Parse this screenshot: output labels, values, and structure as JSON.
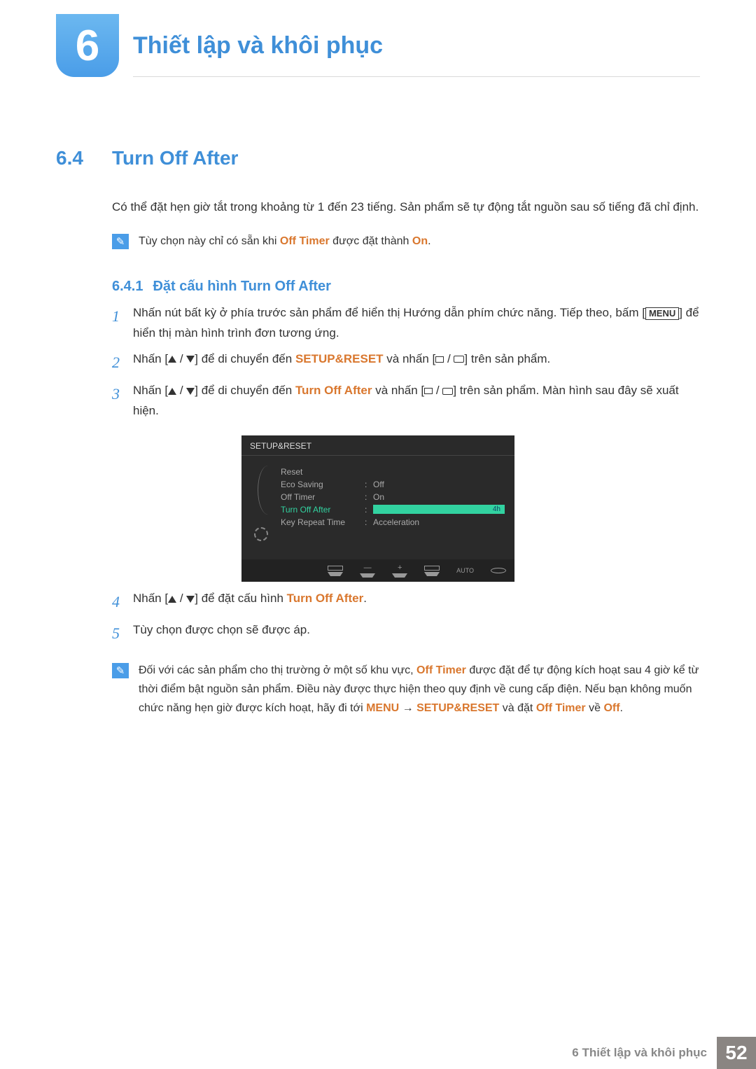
{
  "chapter": {
    "number": "6",
    "title": "Thiết lập và khôi phục"
  },
  "section": {
    "number": "6.4",
    "title": "Turn Off After"
  },
  "intro": "Có thể đặt hẹn giờ tắt trong khoảng từ 1 đến 23 tiếng. Sản phẩm sẽ tự động tắt nguồn sau số tiếng đã chỉ định.",
  "note1": {
    "pre": "Tùy chọn này chỉ có sẵn khi ",
    "kw1": "Off Timer",
    "mid": " được đặt thành ",
    "kw2": "On",
    "post": "."
  },
  "subsection": {
    "number": "6.4.1",
    "title": "Đặt cấu hình Turn Off After"
  },
  "steps": {
    "s1a": "Nhấn nút bất kỳ ở phía trước sản phẩm để hiển thị Hướng dẫn phím chức năng. Tiếp theo, bấm [",
    "s1menu": "MENU",
    "s1b": "] để hiển thị màn hình trình đơn tương ứng.",
    "s2a": "Nhấn [",
    "s2b": "] để di chuyển đến ",
    "s2kw": "SETUP&RESET",
    "s2c": " và nhấn [",
    "s2d": "] trên sản phẩm.",
    "s3a": "Nhấn [",
    "s3b": "] để di chuyển đến ",
    "s3kw": "Turn Off After",
    "s3c": " và nhấn [",
    "s3d": "] trên sản phẩm. Màn hình sau đây sẽ xuất hiện.",
    "s4a": "Nhấn [",
    "s4b": "] để đặt cấu hình ",
    "s4kw": "Turn Off After",
    "s4c": ".",
    "s5": "Tùy chọn được chọn sẽ được áp."
  },
  "osd": {
    "title": "SETUP&RESET",
    "items": {
      "reset": "Reset",
      "eco": "Eco Saving",
      "eco_val": "Off",
      "timer": "Off Timer",
      "timer_val": "On",
      "toa": "Turn Off After",
      "toa_val": "4h",
      "krt": "Key Repeat Time",
      "krt_val": "Acceleration"
    },
    "footer_auto": "AUTO"
  },
  "note2": {
    "t1": "Đối với các sản phẩm cho thị trường ở một số khu vực, ",
    "kw1": "Off Timer",
    "t2": " được đặt để tự động kích hoạt sau 4 giờ kể từ thời điểm bật nguồn sản phẩm. Điều này được thực hiện theo quy định về cung cấp điện. Nếu bạn không muốn chức năng hẹn giờ được kích hoạt, hãy đi tới ",
    "kw2": "MENU",
    "arrow": " → ",
    "kw3": "SETUP&RESET",
    "t3": " và đặt ",
    "kw4": "Off Timer",
    "t4": " về ",
    "kw5": "Off",
    "t5": "."
  },
  "footer": {
    "text": "6 Thiết lập và khôi phục",
    "page": "52"
  }
}
